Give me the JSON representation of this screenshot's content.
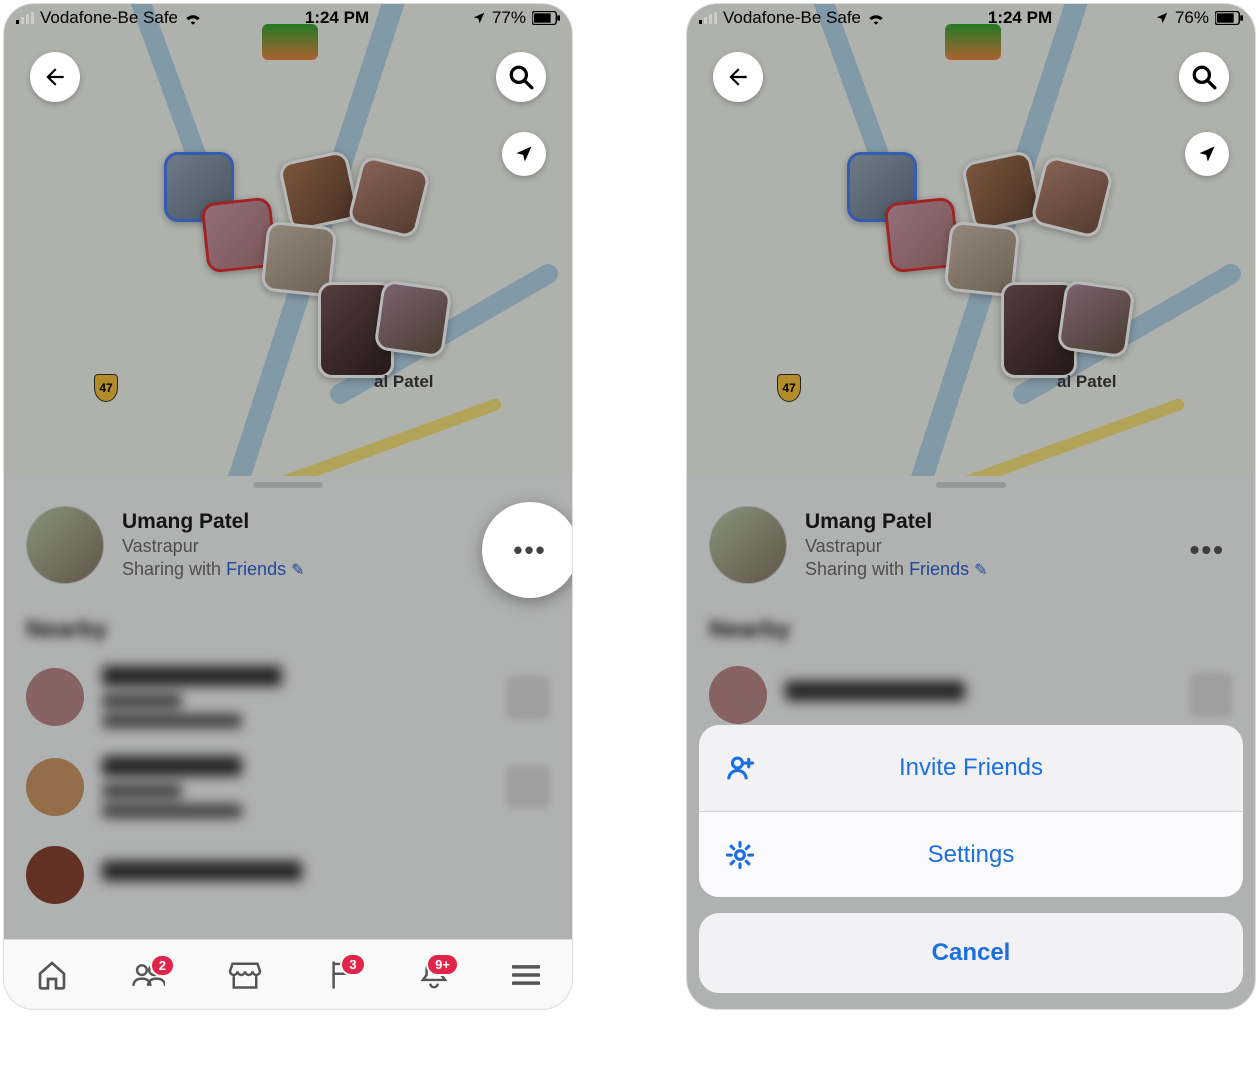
{
  "left": {
    "status": {
      "carrier": "Vodafone-Be Safe",
      "time": "1:24 PM",
      "battery": "77%"
    },
    "map": {
      "shield": "47",
      "label_fragment": "al Patel"
    },
    "profile": {
      "name": "Umang Patel",
      "location": "Vastrapur",
      "sharing_prefix": "Sharing with ",
      "sharing_link": "Friends"
    },
    "nearby_heading": "Nearby",
    "tabbar": {
      "friends_badge": "2",
      "market_badge": "3",
      "notif_badge": "9+"
    }
  },
  "right": {
    "status": {
      "carrier": "Vodafone-Be Safe",
      "time": "1:24 PM",
      "battery": "76%"
    },
    "map": {
      "shield": "47",
      "label_fragment": "al Patel"
    },
    "profile": {
      "name": "Umang Patel",
      "location": "Vastrapur",
      "sharing_prefix": "Sharing with ",
      "sharing_link": "Friends"
    },
    "nearby_heading": "Nearby",
    "action_sheet": {
      "invite": "Invite Friends",
      "settings": "Settings",
      "cancel": "Cancel"
    }
  }
}
